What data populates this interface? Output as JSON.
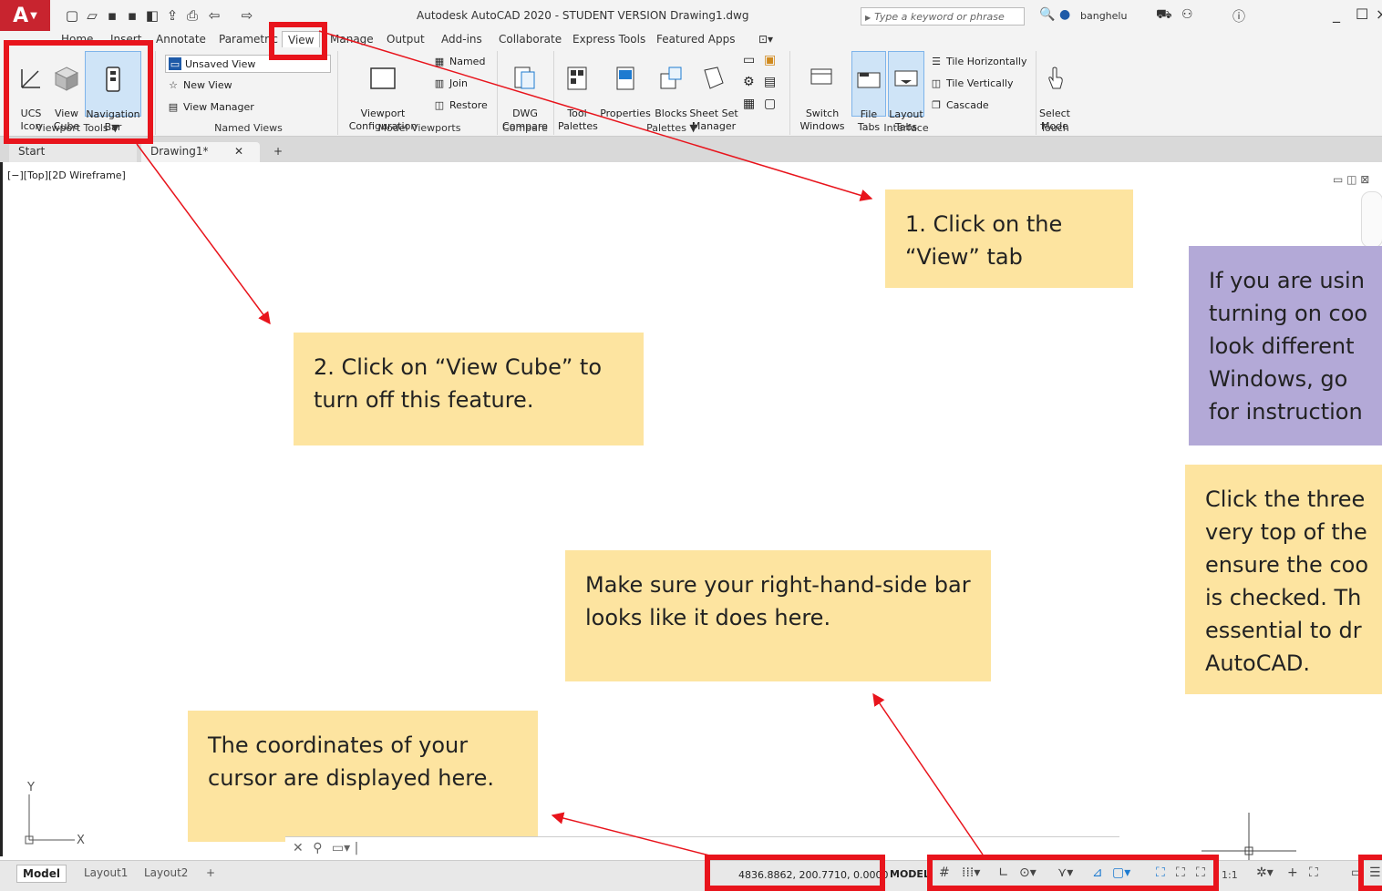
{
  "window": {
    "title": "Autodesk AutoCAD 2020 - STUDENT VERSION   Drawing1.dwg",
    "search_placeholder": "Type a keyword or phrase",
    "username": "banghelu",
    "logo_letter": "A"
  },
  "ribbon_tabs": [
    {
      "label": "Home"
    },
    {
      "label": "Insert"
    },
    {
      "label": "Annotate"
    },
    {
      "label": "Parametric"
    },
    {
      "label": "View"
    },
    {
      "label": "Manage"
    },
    {
      "label": "Output"
    },
    {
      "label": "Add-ins"
    },
    {
      "label": "Collaborate"
    },
    {
      "label": "Express Tools"
    },
    {
      "label": "Featured Apps"
    }
  ],
  "viewport_tools": {
    "title": "Viewport Tools ▼",
    "ucs_icon": "UCS\nIcon",
    "view_cube": "View\nCube",
    "navigation_bar": "Navigation\nBar"
  },
  "named_views": {
    "title": "Named Views",
    "current": "Unsaved View",
    "new_view": "New View",
    "view_manager": "View Manager"
  },
  "model_viewports": {
    "title": "Model Viewports",
    "configuration": "Viewport\nConfiguration",
    "named": "Named",
    "join": "Join",
    "restore": "Restore"
  },
  "compare": {
    "title": "Compare",
    "dwg_compare": "DWG\nCompare"
  },
  "palettes": {
    "title": "Palettes ▼",
    "tool_palettes": "Tool\nPalettes",
    "properties": "Properties",
    "blocks": "Blocks",
    "sheet_set_manager": "Sheet Set\nManager"
  },
  "interface": {
    "title": "Interface",
    "switch_windows": "Switch\nWindows",
    "file_tabs": "File\nTabs",
    "layout_tabs": "Layout\nTabs",
    "tile_horizontally": "Tile Horizontally",
    "tile_vertically": "Tile Vertically",
    "cascade": "Cascade"
  },
  "touch": {
    "title": "Touch",
    "select_mode": "Select\nMode"
  },
  "file_tabs": {
    "start": "Start",
    "drawing": "Drawing1*"
  },
  "viewport_label": "[−][Top][2D Wireframe]",
  "callouts": {
    "step1": "1. Click on the “View” tab",
    "step2": "2. Click on “View Cube” to turn off this feature.",
    "mac_note": "If you are usin turning on coo look different Windows, go for instruction",
    "three_lines": "Click the three very top of the ensure the coo is checked. Th essential to dr AutoCAD.",
    "right_bar": "Make sure your right-hand-side  bar looks like it does here.",
    "coordinates": "The coordinates of your cursor are displayed here."
  },
  "layout_tabs": [
    "Model",
    "Layout1",
    "Layout2",
    "+"
  ],
  "status": {
    "coordinates": "4836.8862, 200.7710, 0.0000",
    "model": "MODEL",
    "scale": "1:1"
  },
  "colors": {
    "highlight": "#e8141c",
    "note_yellow": "#fde4a0",
    "note_purple": "#b3a9d7",
    "brand_red": "#c8242f"
  }
}
